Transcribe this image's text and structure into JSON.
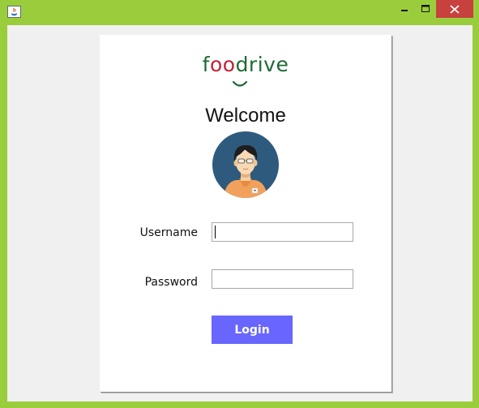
{
  "window": {
    "title": "",
    "frame_color": "#9acd3c",
    "controls": [
      "minimize-icon",
      "maximize-icon",
      "close-icon"
    ],
    "close_color": "#c7413f"
  },
  "logo": {
    "text_part1": "f",
    "text_part2": "oo",
    "text_part3": "drive",
    "green": "#1c6b33",
    "red": "#c21f36"
  },
  "welcome": "Welcome",
  "avatar": {
    "icon": "user-avatar-icon",
    "bg_color": "#2e5a7e"
  },
  "form": {
    "username_label": "Username",
    "username_value": "",
    "password_label": "Password",
    "password_value": "",
    "login_label": "Login",
    "button_color": "#6866fe"
  }
}
